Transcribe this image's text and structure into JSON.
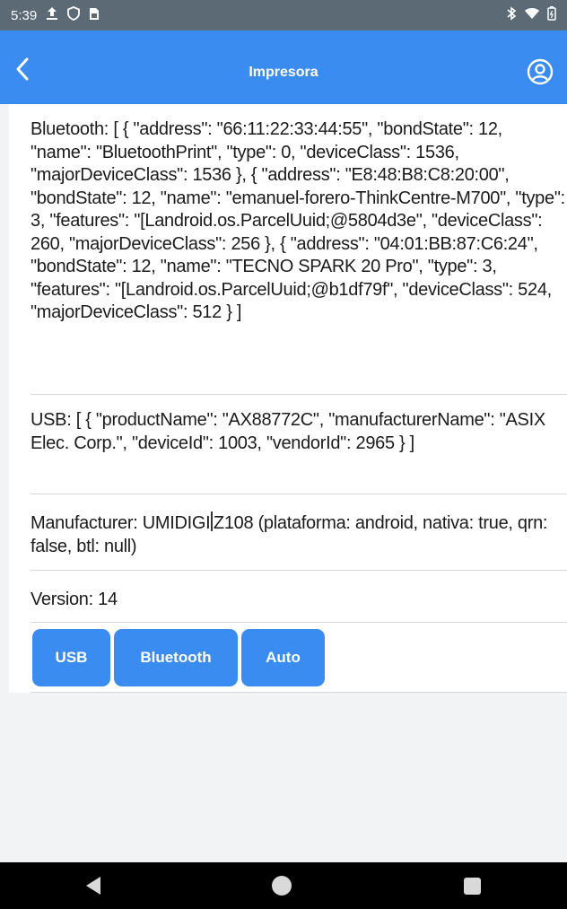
{
  "status_bar": {
    "time": "5:39"
  },
  "app_bar": {
    "title": "Impresora"
  },
  "content": {
    "bluetooth": "Bluetooth: [ { \"address\": \"66:11:22:33:44:55\", \"bondState\": 12, \"name\": \"BluetoothPrint\", \"type\": 0, \"deviceClass\": 1536, \"majorDeviceClass\": 1536 }, { \"address\": \"E8:48:B8:C8:20:00\", \"bondState\": 12, \"name\": \"emanuel-forero-ThinkCentre-M700\", \"type\": 3, \"features\": \"[Landroid.os.ParcelUuid;@5804d3e\", \"deviceClass\": 260, \"majorDeviceClass\": 256 }, { \"address\": \"04:01:BB:87:C6:24\", \"bondState\": 12, \"name\": \"TECNO SPARK 20 Pro\", \"type\": 3, \"features\": \"[Landroid.os.ParcelUuid;@b1df79f\", \"deviceClass\": 524, \"majorDeviceClass\": 512 } ]",
    "usb": "USB: [ { \"productName\": \"AX88772C\", \"manufacturerName\": \"ASIX Elec. Corp.\", \"deviceId\": 1003, \"vendorId\": 2965 } ]",
    "manufacturer_prefix": "Manufacturer: UMIDIGI",
    "manufacturer_suffix": "Z108 (plataforma: android, nativa: true, qrn: false, btl: null)",
    "version": "Version: 14"
  },
  "buttons": {
    "usb": "USB",
    "bluetooth": "Bluetooth",
    "auto": "Auto"
  },
  "colors": {
    "accent": "#3b8cf0",
    "status_bar": "#5b6a75"
  }
}
